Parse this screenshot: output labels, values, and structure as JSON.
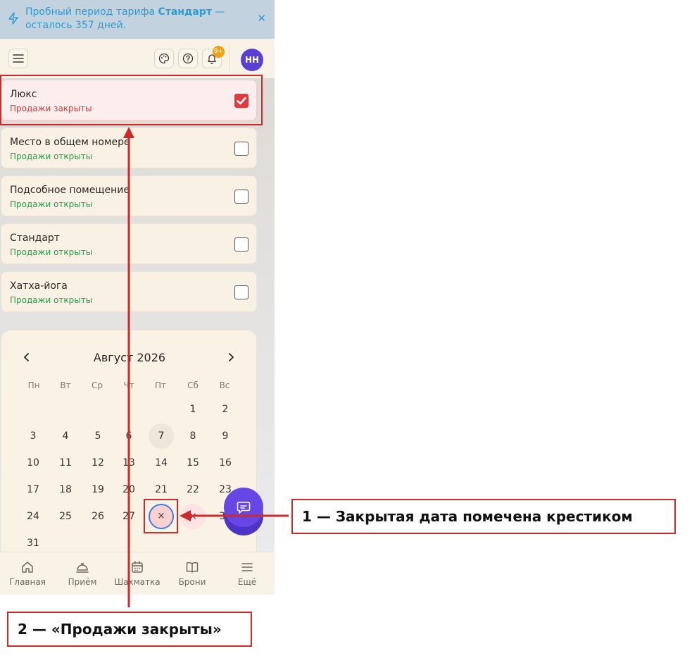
{
  "trial_banner": {
    "text_before": "Пробный период тарифа ",
    "plan": "Стандарт",
    "text_after": " — осталось 357 дней."
  },
  "header": {
    "menu_icon": "hamburger-icon",
    "palette_icon": "palette-icon",
    "help_icon": "help-icon",
    "bell_icon": "bell-icon",
    "notifications_badge": "9+",
    "avatar_initials": "НН"
  },
  "rooms": [
    {
      "name": "Люкс",
      "status": "Продажи закрыты",
      "checked": true
    },
    {
      "name": "Место в общем номере",
      "status": "Продажи открыты",
      "checked": false
    },
    {
      "name": "Подсобное помещение",
      "status": "Продажи открыты",
      "checked": false
    },
    {
      "name": "Стандарт",
      "status": "Продажи открыты",
      "checked": false
    },
    {
      "name": "Хатха-йога",
      "status": "Продажи открыты",
      "checked": false
    }
  ],
  "calendar": {
    "title": "Август 2026",
    "weekdays": [
      "Пн",
      "Вт",
      "Ср",
      "Чт",
      "Пт",
      "Сб",
      "Вс"
    ],
    "today": 7,
    "closed_mark": "×",
    "closed_days": [
      28,
      29
    ]
  },
  "fab": {
    "icon": "chat-icon"
  },
  "bottom_nav": [
    {
      "label": "Главная",
      "icon": "home-icon"
    },
    {
      "label": "Приём",
      "icon": "reception-bell-icon"
    },
    {
      "label": "Шахматка",
      "icon": "calendar-icon"
    },
    {
      "label": "Брони",
      "icon": "book-icon"
    },
    {
      "label": "Ещё",
      "icon": "more-menu-icon"
    }
  ],
  "annotations": {
    "callout_1": "1 — Закрытая дата помечена крестиком",
    "callout_2": "2 — «Продажи закрыты»"
  },
  "colors": {
    "accent": "#6647e6",
    "closed_red": "#d23b3b",
    "open_green": "#21a24a",
    "annotation_red": "#cf2a2a"
  }
}
